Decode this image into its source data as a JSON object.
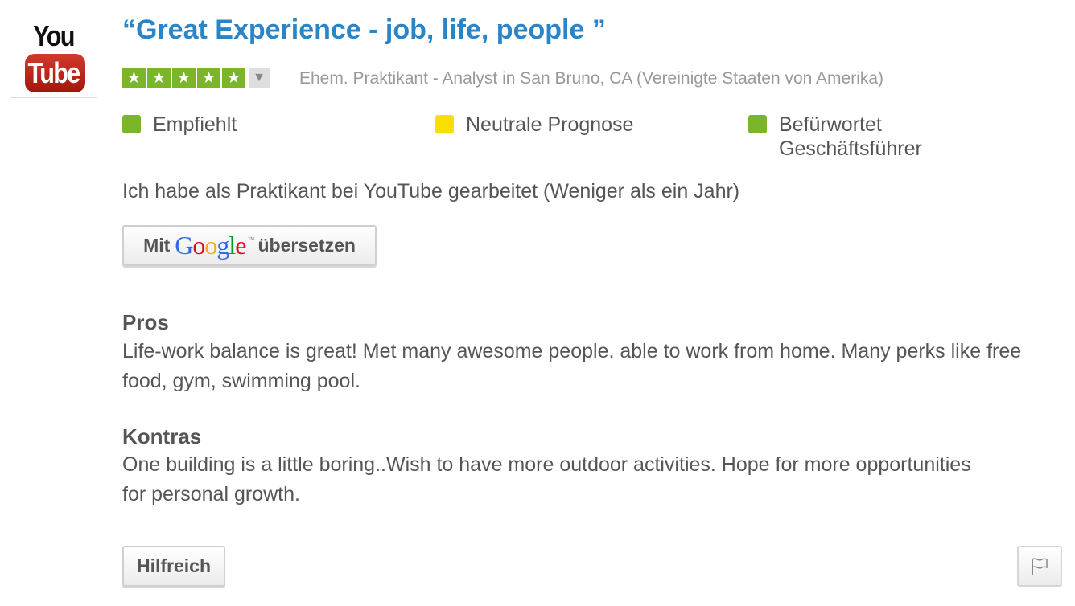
{
  "company": {
    "logo_line1": "You",
    "logo_line2": "Tube"
  },
  "review": {
    "title": "“Great Experience - job, life, people ”",
    "rating_stars": 5,
    "rating_max": 5,
    "reviewer": "Ehem. Praktikant - Analyst in San Bruno, CA (Vereinigte Staaten von Amerika)",
    "flags": [
      {
        "label": "Empfiehlt",
        "color": "#7ab52a"
      },
      {
        "label": "Neutrale Prognose",
        "color": "#f7e000"
      },
      {
        "label": "Befürwortet Geschäftsführer",
        "color": "#7ab52a"
      }
    ],
    "employment": "Ich habe als Praktikant bei YouTube gearbeitet (Weniger als ein Jahr)",
    "translate": {
      "prefix": "Mit",
      "brand": "Google",
      "trademark": "™",
      "suffix": "übersetzen"
    },
    "pros": {
      "heading": "Pros",
      "text": "Life-work balance is great! Met many awesome people. able to work from home. Many perks like free food, gym, swimming pool."
    },
    "cons": {
      "heading": "Kontras",
      "text": "One building is a little boring..Wish to have more outdoor activities. Hope for more opportunities for personal growth."
    },
    "helpful_label": "Hilfreich"
  },
  "icons": {
    "star": "star-icon",
    "dropdown": "triangle-down-icon",
    "report": "flag-icon"
  }
}
